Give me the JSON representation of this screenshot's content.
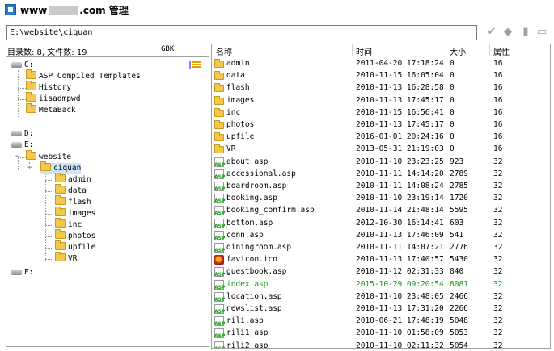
{
  "window": {
    "title_prefix": "www",
    "title_suffix": ".com 管理"
  },
  "toolbar": {
    "path": "E:\\website\\ciquan",
    "buttons": [
      {
        "name": "confirm-icon",
        "glyph": "✔"
      },
      {
        "name": "back-arrow-icon",
        "glyph": "◆"
      },
      {
        "name": "lock-icon",
        "glyph": "▮"
      },
      {
        "name": "window-icon",
        "glyph": "▭"
      }
    ]
  },
  "left": {
    "stats": "目录数: 8, 文件数: 19",
    "encoding": "GBK"
  },
  "tree": {
    "drive_c": "C:",
    "c_children": [
      "ASP Compiled Templates",
      "History",
      "iisadmpwd",
      "MetaBack"
    ],
    "drive_d": "D:",
    "drive_e": "E:",
    "website": "website",
    "ciquan": "ciquan",
    "ciquan_children": [
      "admin",
      "data",
      "flash",
      "images",
      "inc",
      "photos",
      "upfile",
      "VR"
    ],
    "drive_f": "F:"
  },
  "columns": {
    "name": "名称",
    "time": "时间",
    "size": "大小",
    "attr": "属性"
  },
  "files": [
    {
      "type": "folder",
      "name": "admin",
      "time": "2011-04-20 17:18:24",
      "size": "0",
      "attr": "16"
    },
    {
      "type": "folder",
      "name": "data",
      "time": "2010-11-15 16:05:04",
      "size": "0",
      "attr": "16"
    },
    {
      "type": "folder",
      "name": "flash",
      "time": "2010-11-13 16:28:58",
      "size": "0",
      "attr": "16"
    },
    {
      "type": "folder",
      "name": "images",
      "time": "2010-11-13 17:45:17",
      "size": "0",
      "attr": "16"
    },
    {
      "type": "folder",
      "name": "inc",
      "time": "2010-11-15 16:56:41",
      "size": "0",
      "attr": "16"
    },
    {
      "type": "folder",
      "name": "photos",
      "time": "2010-11-13 17:45:17",
      "size": "0",
      "attr": "16"
    },
    {
      "type": "folder",
      "name": "upfile",
      "time": "2016-01-01 20:24:16",
      "size": "0",
      "attr": "16"
    },
    {
      "type": "folder",
      "name": "VR",
      "time": "2013-05-31 21:19:03",
      "size": "0",
      "attr": "16"
    },
    {
      "type": "asp",
      "name": "about.asp",
      "time": "2010-11-10 23:23:25",
      "size": "923",
      "attr": "32"
    },
    {
      "type": "asp",
      "name": "accessional.asp",
      "time": "2010-11-11 14:14:20",
      "size": "2789",
      "attr": "32"
    },
    {
      "type": "asp",
      "name": "boardroom.asp",
      "time": "2010-11-11 14:08:24",
      "size": "2785",
      "attr": "32"
    },
    {
      "type": "asp",
      "name": "booking.asp",
      "time": "2010-11-10 23:19:14",
      "size": "1720",
      "attr": "32"
    },
    {
      "type": "asp",
      "name": "booking_confirm.asp",
      "time": "2010-11-14 21:48:14",
      "size": "5595",
      "attr": "32"
    },
    {
      "type": "asp",
      "name": "bottom.asp",
      "time": "2012-10-30 16:14:41",
      "size": "603",
      "attr": "32"
    },
    {
      "type": "asp",
      "name": "conn.asp",
      "time": "2010-11-13 17:46:09",
      "size": "541",
      "attr": "32"
    },
    {
      "type": "asp",
      "name": "diningroom.asp",
      "time": "2010-11-11 14:07:21",
      "size": "2776",
      "attr": "32"
    },
    {
      "type": "ico",
      "name": "favicon.ico",
      "time": "2010-11-13 17:40:57",
      "size": "5430",
      "attr": "32"
    },
    {
      "type": "asp",
      "name": "guestbook.asp",
      "time": "2010-11-12 02:31:33",
      "size": "840",
      "attr": "32"
    },
    {
      "type": "asp",
      "name": "index.asp",
      "time": "2015-10-29 09:20:54",
      "size": "8081",
      "attr": "32",
      "highlight": true
    },
    {
      "type": "asp",
      "name": "location.asp",
      "time": "2010-11-10 23:48:05",
      "size": "2466",
      "attr": "32"
    },
    {
      "type": "asp",
      "name": "newslist.asp",
      "time": "2010-11-13 17:31:20",
      "size": "2266",
      "attr": "32"
    },
    {
      "type": "asp",
      "name": "rili.asp",
      "time": "2010-06-21 17:48:19",
      "size": "5048",
      "attr": "32"
    },
    {
      "type": "asp",
      "name": "rili1.asp",
      "time": "2010-11-10 01:58:09",
      "size": "5053",
      "attr": "32"
    },
    {
      "type": "asp",
      "name": "rili2.asp",
      "time": "2010-11-10 02:11:32",
      "size": "5054",
      "attr": "32"
    }
  ]
}
